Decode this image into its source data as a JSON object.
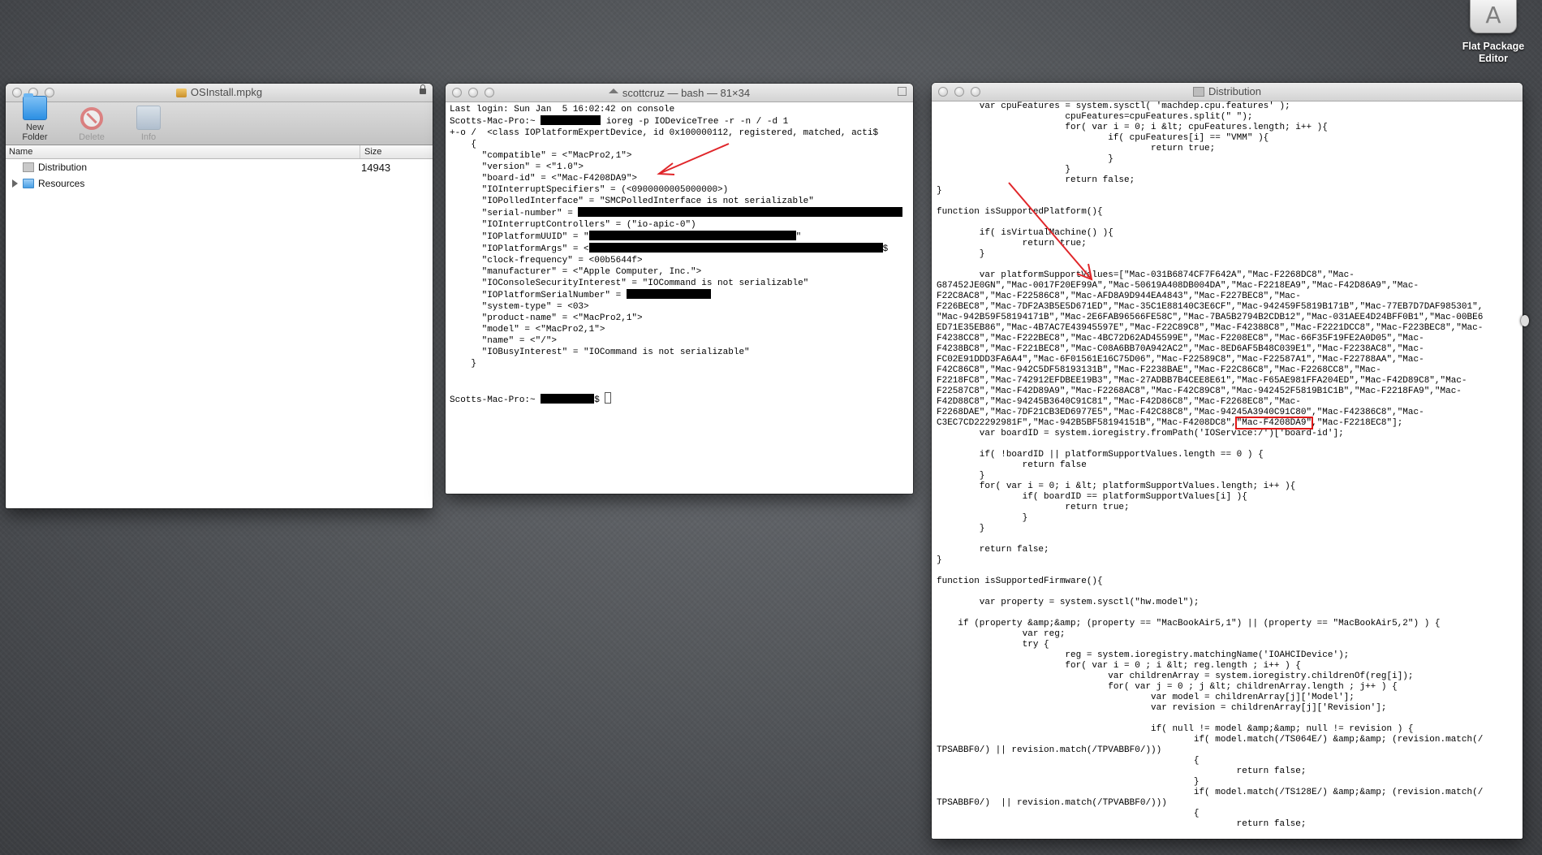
{
  "desktop": {
    "app_label_line1": "Flat Package",
    "app_label_line2": "Editor"
  },
  "pkg_window": {
    "title": "OSInstall.mpkg",
    "toolbar": {
      "new_folder": "New Folder",
      "delete": "Delete",
      "info": "Info"
    },
    "columns": {
      "name": "Name",
      "size": "Size"
    },
    "rows": [
      {
        "name": "Distribution",
        "size": "14943"
      },
      {
        "name": "Resources",
        "size": ""
      }
    ]
  },
  "terminal_window": {
    "title": "scottcruz — bash — 81×34",
    "lines": [
      "Last login: Sun Jan  5 16:02:42 on console",
      "Scotts-Mac-Pro:~ ",
      " ioreg -p IODeviceTree -r -n / -d 1",
      "+-o /  <class IOPlatformExpertDevice, id 0x100000112, registered, matched, acti$",
      "    {",
      "      \"compatible\" = <\"MacPro2,1\">",
      "      \"version\" = <\"1.0\">",
      "      \"board-id\" = <\"Mac-F4208DA9\">",
      "      \"IOInterruptSpecifiers\" = (<0900000005000000>)",
      "      \"IOPolledInterface\" = \"SMCPolledInterface is not serializable\"",
      "      \"serial-number\" = ",
      "      \"IOInterruptControllers\" = (\"io-apic-0\")",
      "      \"IOPlatformUUID\" = \"",
      "\"",
      "      \"IOPlatformArgs\" = <",
      "$",
      "      \"clock-frequency\" = <00b5644f>",
      "      \"manufacturer\" = <\"Apple Computer, Inc.\">",
      "      \"IOConsoleSecurityInterest\" = \"IOCommand is not serializable\"",
      "      \"IOPlatformSerialNumber\" = ",
      "      \"system-type\" = <03>",
      "      \"product-name\" = <\"MacPro2,1\">",
      "      \"model\" = <\"MacPro2,1\">",
      "      \"name\" = <\"/\">",
      "      \"IOBusyInterest\" = \"IOCommand is not serializable\"",
      "    }",
      "Scotts-Mac-Pro:~ ",
      "$ "
    ]
  },
  "dist_window": {
    "title": "Distribution",
    "code": [
      "        var cpuFeatures = system.sysctl( 'machdep.cpu.features' );",
      "                        cpuFeatures=cpuFeatures.split(\" \");",
      "                        for( var i = 0; i &lt; cpuFeatures.length; i++ ){",
      "                                if( cpuFeatures[i] == \"VMM\" ){",
      "                                        return true;",
      "                                }",
      "                        }",
      "                        return false;",
      "}",
      "",
      "function isSupportedPlatform(){",
      "",
      "        if( isVirtualMachine() ){",
      "                return true;",
      "        }",
      "",
      "        var platformSupportValues=[\"Mac-031B6874CF7F642A\",\"Mac-F2268DC8\",\"Mac-",
      "G87452JE0GN\",\"Mac-0017F20EF99A\",\"Mac-50619A408DB004DA\",\"Mac-F2218EA9\",\"Mac-F42D86A9\",\"Mac-",
      "F22C8AC8\",\"Mac-F22586C8\",\"Mac-AFD8A9D944EA4843\",\"Mac-F227BEC8\",\"Mac-",
      "F226BEC8\",\"Mac-7DF2A3B5E5D671ED\",\"Mac-35C1E88140C3E6CF\",\"Mac-942459F5819B171B\",\"Mac-77EB7D7DAF985301\",",
      "\"Mac-942B59F58194171B\",\"Mac-2E6FAB96566FE58C\",\"Mac-7BA5B2794B2CDB12\",\"Mac-031AEE4D24BFF0B1\",\"Mac-00BE6",
      "ED71E35EB86\",\"Mac-4B7AC7E43945597E\",\"Mac-F22C89C8\",\"Mac-F42388C8\",\"Mac-F2221DCC8\",\"Mac-F223BEC8\",\"Mac-",
      "F4238CC8\",\"Mac-F222BEC8\",\"Mac-4BC72D62AD45599E\",\"Mac-F2208EC8\",\"Mac-66F35F19FE2A0D05\",\"Mac-",
      "F4238BC8\",\"Mac-F221BEC8\",\"Mac-C08A6BB70A942AC2\",\"Mac-8ED6AF5B48C039E1\",\"Mac-F2238AC8\",\"Mac-",
      "FC02E91DDD3FA6A4\",\"Mac-6F01561E16C75D06\",\"Mac-F22589C8\",\"Mac-F22587A1\",\"Mac-F22788AA\",\"Mac-",
      "F42C86C8\",\"Mac-942C5DF58193131B\",\"Mac-F2238BAE\",\"Mac-F22C86C8\",\"Mac-F2268CC8\",\"Mac-",
      "F2218FC8\",\"Mac-742912EFDBEE19B3\",\"Mac-27ADBB7B4CEE8E61\",\"Mac-F65AE981FFA204ED\",\"Mac-F42D89C8\",\"Mac-",
      "F22587C8\",\"Mac-F42D89A9\",\"Mac-F2268AC8\",\"Mac-F42C89C8\",\"Mac-942452F5819B1C1B\",\"Mac-F2218FA9\",\"Mac-",
      "F42D88C8\",\"Mac-94245B3640C91C81\",\"Mac-F42D86C8\",\"Mac-F2268EC8\",\"Mac-",
      "F2268DAE\",\"Mac-7DF21CB3ED6977E5\",\"Mac-F42C88C8\",\"Mac-94245A3940C91C80\",\"Mac-F42386C8\",\"Mac-",
      "C3EC7CD22292981F\",\"Mac-942B5BF58194151B\",\"Mac-F4208DC8\",",
      "\"Mac-F4208DA9\"",
      ",\"Mac-F2218EC8\"];",
      "        var boardID = system.ioregistry.fromPath('IOService:/')['board-id'];",
      "",
      "        if( !boardID || platformSupportValues.length == 0 ) {",
      "                return false",
      "        }",
      "        for( var i = 0; i &lt; platformSupportValues.length; i++ ){",
      "                if( boardID == platformSupportValues[i] ){",
      "                        return true;",
      "                }",
      "        }",
      "",
      "        return false;",
      "}",
      "",
      "function isSupportedFirmware(){",
      "",
      "        var property = system.sysctl(\"hw.model\");",
      "",
      "    if (property &amp;&amp; (property == \"MacBookAir5,1\") || (property == \"MacBookAir5,2\") ) {",
      "                var reg;",
      "                try {",
      "                        reg = system.ioregistry.matchingName('IOAHCIDevice');",
      "                        for( var i = 0 ; i &lt; reg.length ; i++ ) {",
      "                                var childrenArray = system.ioregistry.childrenOf(reg[i]);",
      "                                for( var j = 0 ; j &lt; childrenArray.length ; j++ ) {",
      "                                        var model = childrenArray[j]['Model'];",
      "                                        var revision = childrenArray[j]['Revision'];",
      "",
      "                                        if( null != model &amp;&amp; null != revision ) {",
      "                                                if( model.match(/TS064E/) &amp;&amp; (revision.match(/",
      "TPSABBF0/) || revision.match(/TPVABBF0/)))",
      "                                                {",
      "                                                        return false;",
      "                                                }",
      "                                                if( model.match(/TS128E/) &amp;&amp; (revision.match(/",
      "TPSABBF0/)  || revision.match(/TPVABBF0/)))",
      "                                                {",
      "                                                        return false;"
    ]
  }
}
